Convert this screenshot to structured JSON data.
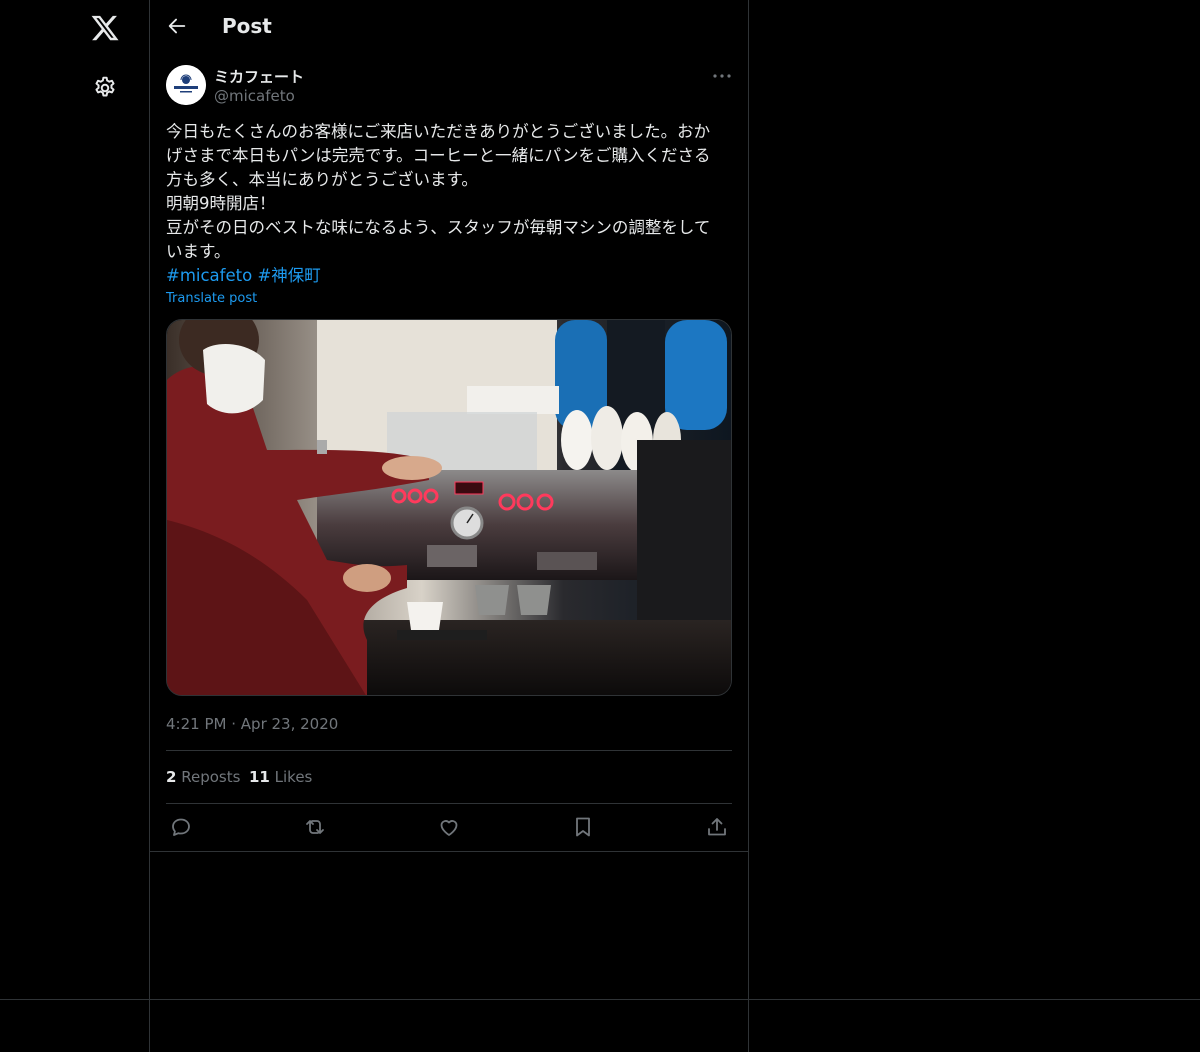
{
  "nav": {
    "logo_icon": "x-logo-icon",
    "settings_icon": "gear-icon"
  },
  "header": {
    "title": "Post",
    "back_icon": "arrow-left-icon"
  },
  "author": {
    "name": "ミカフェート",
    "handle": "@micafeto",
    "avatar_text": "MICAFETO"
  },
  "post": {
    "lines": [
      "今日もたくさんのお客様にご来店いただきありがとうございました。おか",
      "げさまで本日もパンは完売です。コーヒーと一緒にパンをご購入くださる",
      "方も多く、本当にありがとうございます。",
      "明朝9時開店！",
      "豆がその日のベストな味になるよう、スタッフが毎朝マシンの調整をして",
      "います。"
    ],
    "hashtags": [
      "#micafeto",
      "#神保町"
    ],
    "translate_label": "Translate post",
    "time": "4:21 PM",
    "separator": "·",
    "date": "Apr 23, 2020"
  },
  "stats": {
    "reposts_count": "2",
    "reposts_label": "Reposts",
    "likes_count": "11",
    "likes_label": "Likes"
  },
  "colors": {
    "background": "#000000",
    "text": "#e7e9ea",
    "secondary": "#71767b",
    "accent": "#1d9bf0",
    "border": "#2f3336"
  }
}
